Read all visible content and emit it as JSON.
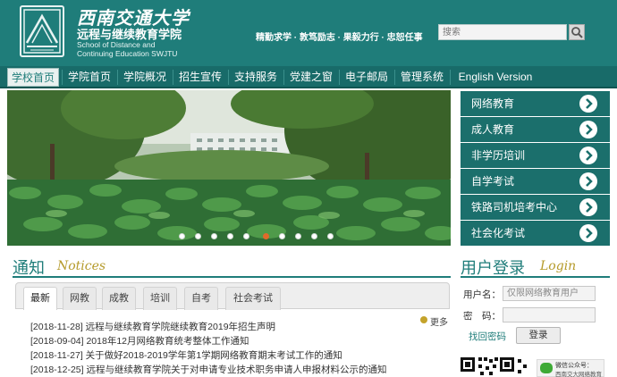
{
  "header": {
    "school_name_cn": "西南交通大学",
    "college_name_cn": "远程与继续教育学院",
    "college_name_en_line1": "School of Distance and",
    "college_name_en_line2": "Continuing  Education SWJTU",
    "motto": "精勤求学 · 敦笃励志 · 果毅力行 · 忠恕任事",
    "search_placeholder": "搜索",
    "colors": {
      "header_bg": "#1f7d7a",
      "nav_bg": "#186b69",
      "accent_gold": "#b59a2a"
    }
  },
  "nav": {
    "items": [
      "学校首页",
      "学院首页",
      "学院概况",
      "招生宣传",
      "支持服务",
      "党建之窗",
      "电子邮局",
      "管理系统",
      "English Version"
    ],
    "active": "学校首页"
  },
  "banner": {
    "slide_count": 10,
    "active_slide": 6
  },
  "side_menu": {
    "items": [
      "网络教育",
      "成人教育",
      "非学历培训",
      "自学考试",
      "铁路司机培考中心",
      "社会化考试"
    ],
    "arrow_icon": "chevron-right-icon"
  },
  "notices": {
    "title": "通知",
    "subtitle": "Notices",
    "tabs": [
      "最新",
      "网教",
      "成教",
      "培训",
      "自考",
      "社会考试"
    ],
    "active_tab": "最新",
    "more_label": "更多",
    "items": [
      "[2018-11-28] 远程与继续教育学院继续教育2019年招生声明",
      "[2018-09-04] 2018年12月网络教育统考整体工作通知",
      "[2018-11-27] 关于做好2018-2019学年第1学期网络教育期末考试工作的通知",
      "[2018-12-25] 远程与继续教育学院关于对申请专业技术职务申请人申报材料公示的通知"
    ]
  },
  "login": {
    "title": "用户登录",
    "subtitle": "Login",
    "username_label": "用户名：",
    "username_placeholder": "仅限网络教育用户",
    "password_label": "密　码：",
    "forgot_label": "找回密码",
    "submit_label": "登录",
    "wechat_title": "微信公众号：",
    "wechat_name": "西南交大网络教育"
  }
}
